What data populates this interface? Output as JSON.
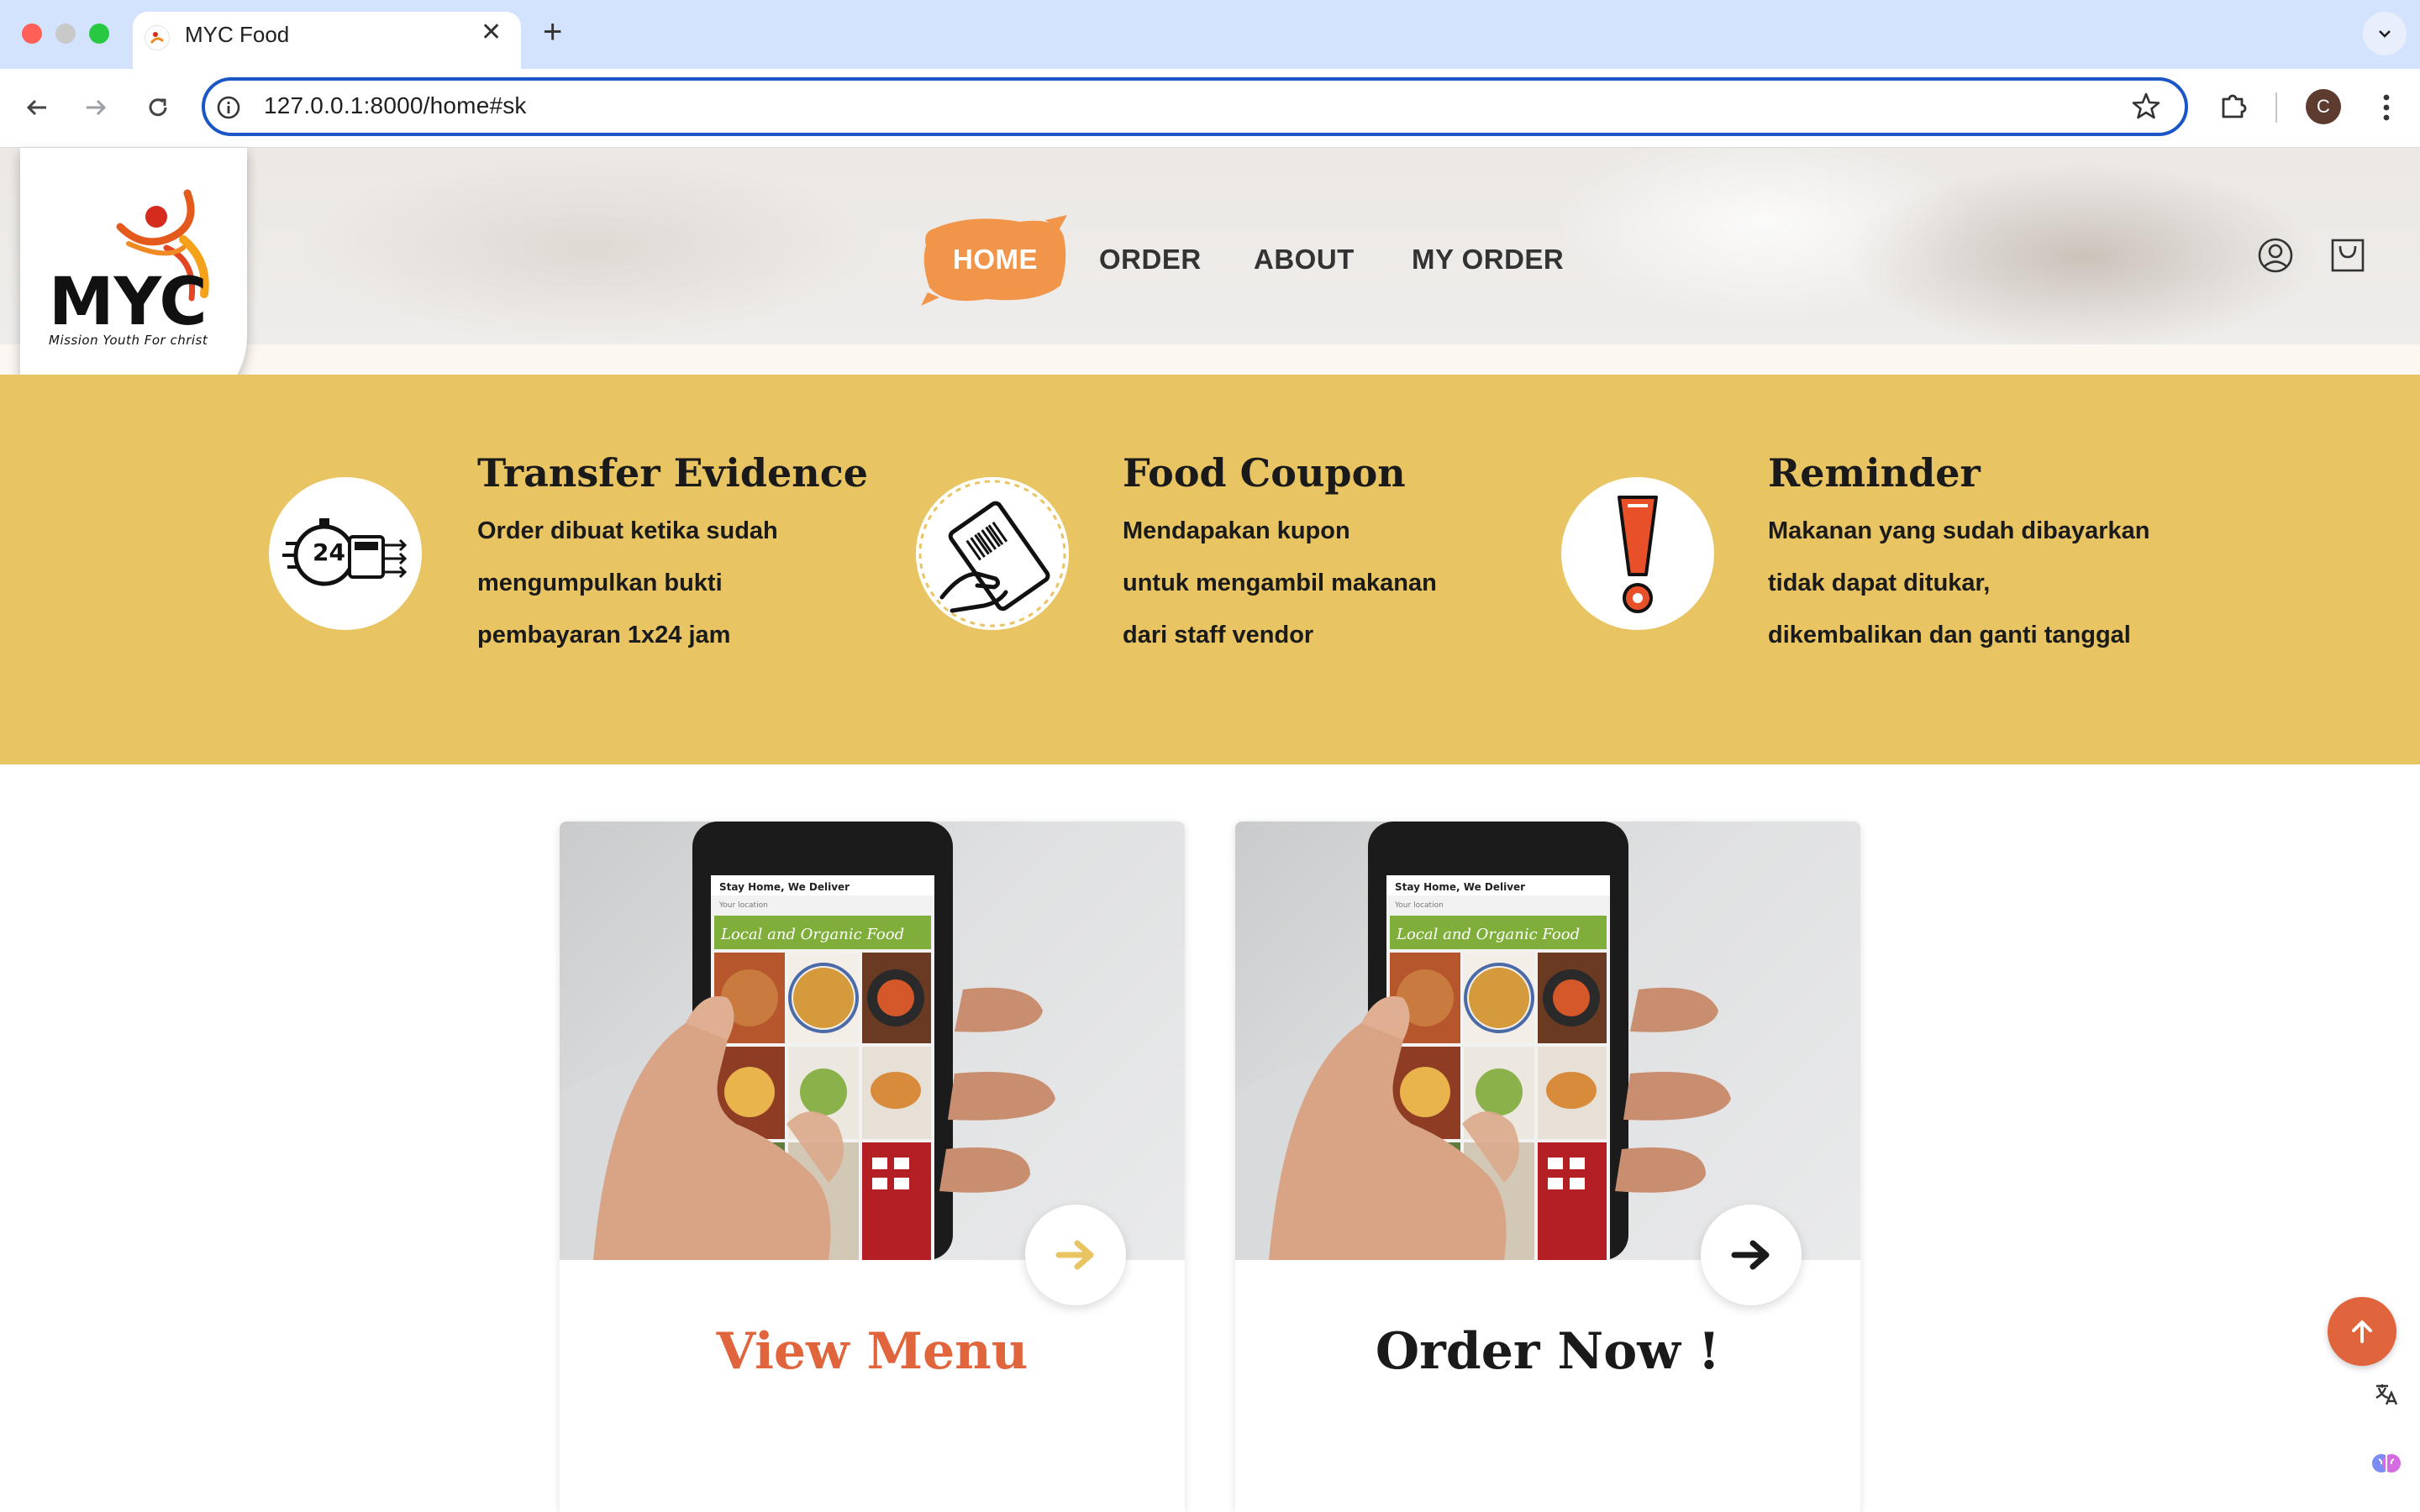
{
  "browser": {
    "tab_title": "MYC Food",
    "url": "127.0.0.1:8000/home#sk",
    "profile_initial": "C"
  },
  "logo": {
    "wordmark": "MYC",
    "tagline": "Mission Youth For christ"
  },
  "nav": {
    "items": [
      {
        "label": "HOME",
        "active": true
      },
      {
        "label": "ORDER",
        "active": false
      },
      {
        "label": "ABOUT",
        "active": false
      },
      {
        "label": "MY ORDER",
        "active": false
      }
    ]
  },
  "features": [
    {
      "icon": "24-hour-payment-icon",
      "title": "Transfer Evidence",
      "lines": [
        "Order dibuat ketika sudah",
        "mengumpulkan bukti",
        "pembayaran 1x24 jam"
      ]
    },
    {
      "icon": "coupon-ticket-icon",
      "title": "Food Coupon",
      "lines": [
        "Mendapakan kupon",
        "untuk mengambil makanan",
        "dari staff vendor"
      ]
    },
    {
      "icon": "exclamation-icon",
      "title": "Reminder",
      "lines": [
        "Makanan yang sudah dibayarkan",
        "tidak dapat ditukar,",
        "dikembalikan dan ganti tanggal"
      ]
    }
  ],
  "cards": [
    {
      "title": "View Menu",
      "title_color": "#e0643c",
      "arrow_color": "#e8c562"
    },
    {
      "title": "Order Now !",
      "title_color": "#1a1a1a",
      "arrow_color": "#1a1a1a"
    }
  ],
  "phone_screen": {
    "header": "Stay Home, We Deliver",
    "location": "Your location",
    "banner": "Local and Organic Food"
  },
  "colors": {
    "accent": "#e0643c",
    "features_bg": "#e8c562",
    "home_brush": "#f0954a"
  }
}
